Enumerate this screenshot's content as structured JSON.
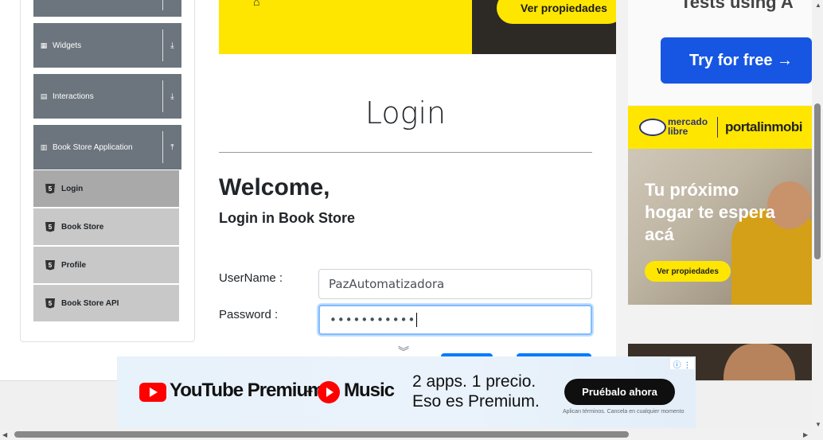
{
  "sidebar": {
    "groups": [
      {
        "label": "Widgets",
        "icon": "grid-icon",
        "arrow": "⤓"
      },
      {
        "label": "Interactions",
        "icon": "square-icon",
        "arrow": "⤓"
      },
      {
        "label": "Book Store Application",
        "icon": "books-icon",
        "arrow": "⤒"
      }
    ],
    "items": [
      {
        "label": "Login"
      },
      {
        "label": "Book Store"
      },
      {
        "label": "Profile"
      },
      {
        "label": "Book Store API"
      }
    ],
    "html5_glyph": "5"
  },
  "top_ad": {
    "cta": "Ver propiedades"
  },
  "main": {
    "title": "Login",
    "welcome": "Welcome,",
    "subtitle": "Login in Book Store",
    "username_label": "UserName :",
    "username_value": "PazAutomatizadora",
    "password_label": "Password :",
    "password_value": "•••••••••••"
  },
  "right_ads": {
    "tests_text": "Tests using A",
    "try_label": "Try for free →",
    "ml_brand_line1": "mercado",
    "ml_brand_line2": "libre",
    "ml_portal": "portalinmobi",
    "ml_headline": "Tu próximo hogar te espera acá",
    "ml_cta": "Ver propiedades"
  },
  "bottom_ad": {
    "brand1": "YouTube Premium",
    "plus": "+",
    "brand2": "Music",
    "line1": "2 apps. 1 precio.",
    "line2": "Eso es Premium.",
    "cta": "Pruébalo ahora",
    "fine_print": "Aplican términos. Cancela en cualquier momento",
    "adchoice": "ⓘ ⋮"
  },
  "colors": {
    "sidebar_group": "#6c757d",
    "menu_item": "#c8c8c8",
    "menu_item_active": "#a9a9a9",
    "accent": "#007bff",
    "ad_yellow": "#ffe600"
  }
}
